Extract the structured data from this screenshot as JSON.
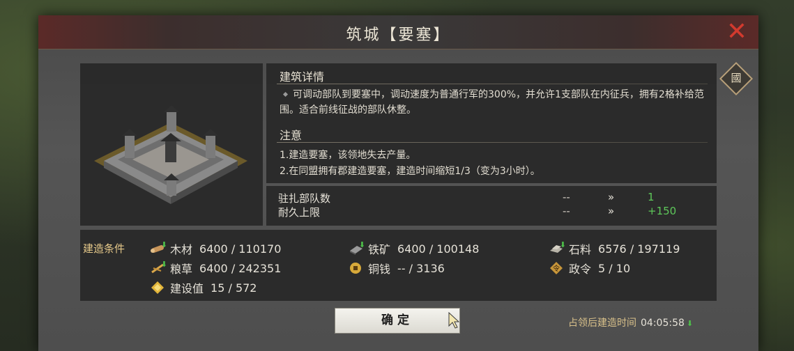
{
  "window": {
    "title": "筑城【要塞】",
    "close_icon": "close-icon",
    "side_button_label": "國"
  },
  "detail": {
    "heading": "建筑详情",
    "text": "可调动部队到要塞中，调动速度为普通行军的300%，并允许1支部队在内征兵，拥有2格补给范围。适合前线征战的部队休整。",
    "note_heading": "注意",
    "note_lines": [
      "1.建造要塞，该领地失去产量。",
      "2.在同盟拥有郡建造要塞，建造时间缩短1/3（变为3小时）。"
    ]
  },
  "stats": [
    {
      "label": "驻扎部队数",
      "old": "--",
      "arrow": "»",
      "new": "1"
    },
    {
      "label": "耐久上限",
      "old": "--",
      "arrow": "»",
      "new": "+150"
    }
  ],
  "requirements": {
    "title": "建造条件",
    "items": [
      {
        "icon": "wood-icon",
        "name": "木材",
        "value": "6400 / 110170"
      },
      {
        "icon": "iron-icon",
        "name": "铁矿",
        "value": "6400 / 100148"
      },
      {
        "icon": "stone-icon",
        "name": "石料",
        "value": "6576 / 197119"
      },
      {
        "icon": "grain-icon",
        "name": "粮草",
        "value": "6400 / 242351"
      },
      {
        "icon": "coin-icon",
        "name": "铜钱",
        "value": "-- / 3136"
      },
      {
        "icon": "decree-icon",
        "name": "政令",
        "value": "5 / 10"
      },
      {
        "icon": "build-points-icon",
        "name": "建设值",
        "value": "15 / 572"
      }
    ]
  },
  "footer": {
    "confirm_label": "确定",
    "timer_label": "占领后建造时间",
    "timer_value": "04:05:58"
  },
  "colors": {
    "accent_green": "#5ec85a",
    "title_red": "#d23a2e",
    "label_gold": "#e6c98a"
  }
}
